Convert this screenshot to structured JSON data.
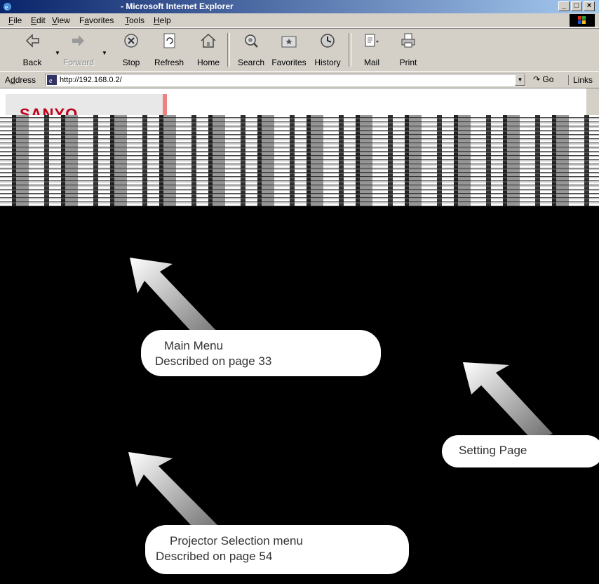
{
  "window": {
    "title": "- Microsoft Internet Explorer"
  },
  "menu": [
    {
      "u": "F",
      "rest": "ile"
    },
    {
      "u": "E",
      "rest": "dit"
    },
    {
      "u": "V",
      "rest": "iew"
    },
    {
      "pre": "F",
      "u": "a",
      "rest": "vorites"
    },
    {
      "u": "T",
      "rest": "ools"
    },
    {
      "u": "H",
      "rest": "elp"
    }
  ],
  "toolbar": {
    "back": "Back",
    "forward": "Forward",
    "stop": "Stop",
    "refresh": "Refresh",
    "home": "Home",
    "search": "Search",
    "favorites": "Favorites",
    "history": "History",
    "mail": "Mail",
    "print": "Print"
  },
  "address": {
    "label_pre": "A",
    "label_u": "d",
    "label_rest": "dress",
    "url": "http://192.168.0.2/",
    "go": "Go",
    "links": "Links"
  },
  "page": {
    "logo": "SANYO"
  },
  "callouts": {
    "main_menu": {
      "line1": "Main Menu",
      "line2": "Described on page 33"
    },
    "setting": {
      "line1": "Setting Page"
    },
    "projector": {
      "line1": "Projector Selection menu",
      "line2": "Described on page 54"
    }
  }
}
